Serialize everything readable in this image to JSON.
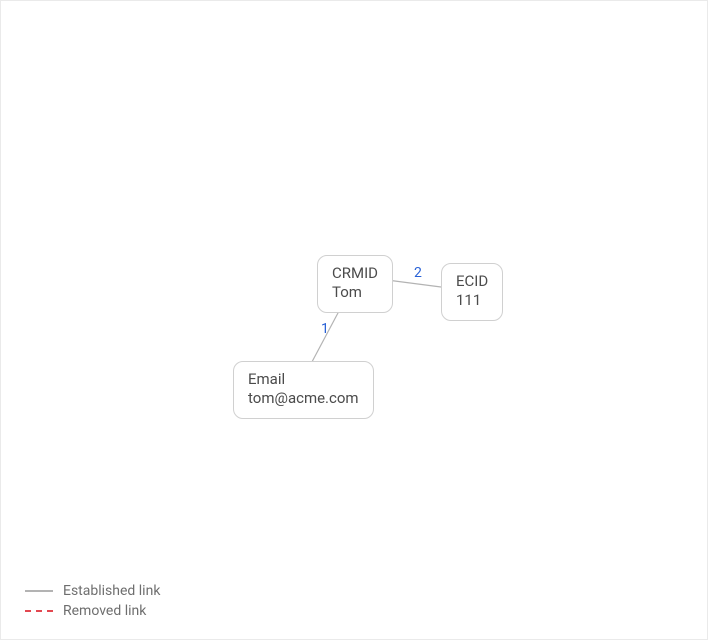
{
  "nodes": {
    "crmid": {
      "line1": "CRMID",
      "line2": "Tom"
    },
    "ecid": {
      "line1": "ECID",
      "line2": "111"
    },
    "email": {
      "line1": "Email",
      "line2": "tom@acme.com"
    }
  },
  "edges": {
    "e1": {
      "label": "1"
    },
    "e2": {
      "label": "2"
    }
  },
  "legend": {
    "established": "Established link",
    "removed": "Removed link"
  }
}
